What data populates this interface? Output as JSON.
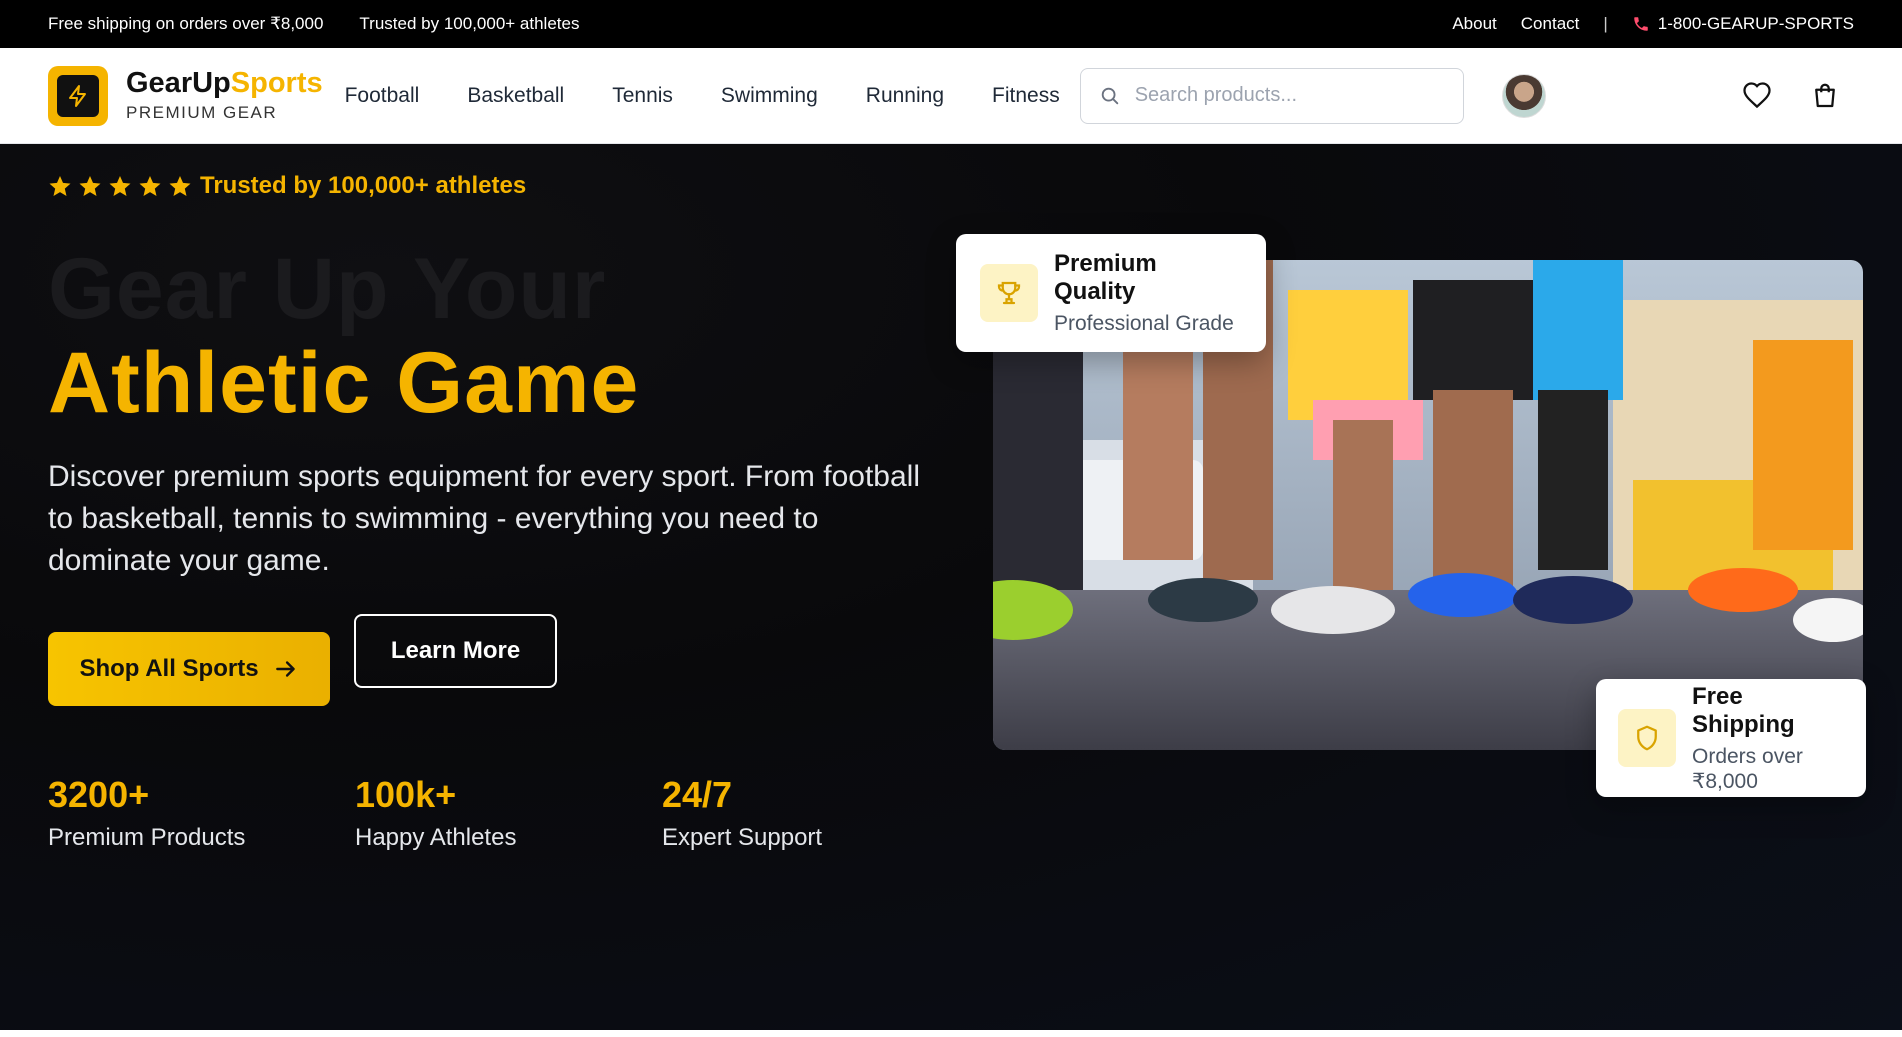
{
  "topbar": {
    "shipping": "Free shipping on orders over ₹8,000",
    "trusted": "Trusted by 100,000+ athletes",
    "about": "About",
    "contact": "Contact",
    "separator": "|",
    "phone": "1-800-GEARUP-SPORTS"
  },
  "header": {
    "brand_part1": "GearUp",
    "brand_part2": "Sports",
    "brand_sub": "PREMIUM GEAR",
    "nav": [
      "Football",
      "Basketball",
      "Tennis",
      "Swimming",
      "Running",
      "Fitness"
    ],
    "search_placeholder": "Search products..."
  },
  "hero": {
    "trust_text": "Trusted by 100,000+ athletes",
    "star_count": 5,
    "headline_line1": "Gear Up Your",
    "headline_line2": "Athletic Game",
    "description": "Discover premium sports equipment for every sport. From football to basketball, tennis to swimming - everything you need to dominate your game.",
    "primary_button": "Shop All Sports",
    "secondary_button": "Learn More",
    "stats": [
      {
        "value": "3200+",
        "label": "Premium Products"
      },
      {
        "value": "100k+",
        "label": "Happy Athletes"
      },
      {
        "value": "24/7",
        "label": "Expert Support"
      }
    ],
    "card_quality": {
      "title": "Premium Quality",
      "subtitle": "Professional Grade"
    },
    "card_shipping": {
      "title": "Free Shipping",
      "subtitle": "Orders over ₹8,000"
    }
  },
  "colors": {
    "accent": "#f5b400",
    "hero_bg": "#09090b",
    "topbar_bg": "#000000"
  },
  "icons": [
    "phone-icon",
    "bolt-icon",
    "search-icon",
    "heart-icon",
    "cart-icon",
    "star-icon",
    "arrow-right-icon",
    "trophy-icon",
    "shield-icon"
  ]
}
